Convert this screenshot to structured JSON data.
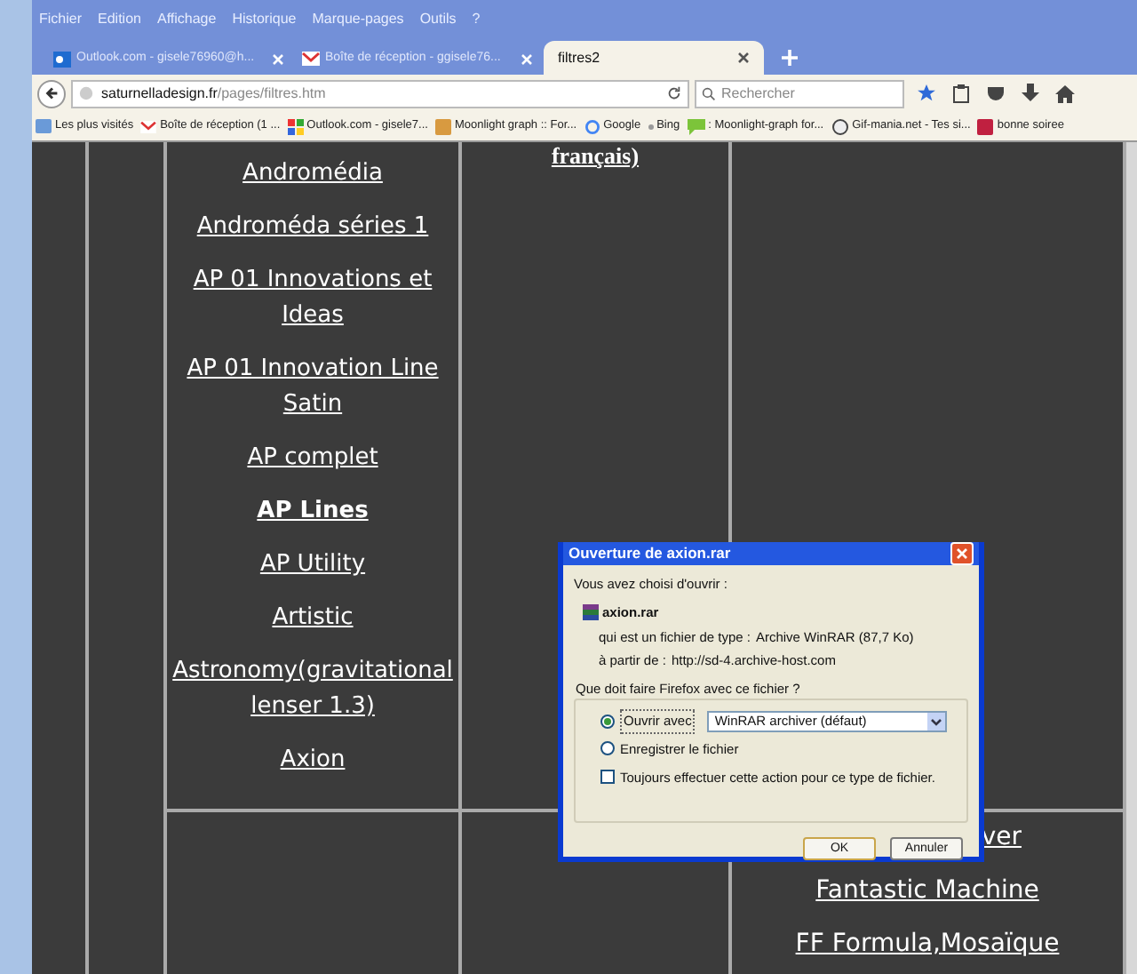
{
  "menu": [
    "Fichier",
    "Edition",
    "Affichage",
    "Historique",
    "Marque-pages",
    "Outils",
    "?"
  ],
  "tabs": [
    {
      "label": "Outlook.com - gisele76960@h...",
      "selected": false,
      "kind": "outlook"
    },
    {
      "label": "Boîte de réception - ggisele76...",
      "selected": false,
      "kind": "gmail"
    },
    {
      "label": "filtres2",
      "selected": true,
      "kind": "plain"
    }
  ],
  "address": {
    "host": "saturnelladesign.fr",
    "path": "/pages/filtres.htm"
  },
  "search": {
    "placeholder": "Rechercher"
  },
  "bookmarks": [
    {
      "label": "Les plus visités",
      "kind": "star"
    },
    {
      "label": "Boîte de réception (1 ...",
      "kind": "gmail"
    },
    {
      "label": "Outlook.com - gisele7...",
      "kind": "windows"
    },
    {
      "label": "Moonlight graph :: For...",
      "kind": "moon"
    },
    {
      "label": "Google",
      "kind": "google"
    },
    {
      "label": "Bing",
      "kind": "dot"
    },
    {
      "label": ": Moonlight-graph for...",
      "kind": "chat"
    },
    {
      "label": "Gif-mania.net - Tes si...",
      "kind": "gif"
    },
    {
      "label": "bonne soiree",
      "kind": "red"
    }
  ],
  "content": {
    "column_3_top": "français)",
    "links": [
      {
        "label": "Andromédia",
        "bold": false
      },
      {
        "label": "Androméda séries 1",
        "bold": false
      },
      {
        "label": "AP 01 Innovations et Ideas",
        "bold": false
      },
      {
        "label": "AP 01 Innovation Line Satin",
        "bold": false
      },
      {
        "label": "AP complet",
        "bold": false
      },
      {
        "label": "AP Lines",
        "bold": true
      },
      {
        "label": "AP Utility",
        "bold": false
      },
      {
        "label": "Artistic",
        "bold": false
      },
      {
        "label": "Astronomy(gravitational lenser 1.3)",
        "bold": false
      },
      {
        "label": "Axion",
        "bold": false
      }
    ],
    "lower_links": [
      "ver",
      "Fantastic Machine",
      "FF Formula,Mosaïque"
    ]
  },
  "dialog": {
    "title": "Ouverture de axion.rar",
    "intro": "Vous avez choisi d'ouvrir :",
    "file": "axion.rar",
    "type_label": "qui est un fichier de type :",
    "type_value": "Archive WinRAR (87,7 Ko)",
    "from_label": "à partir de :",
    "from_value": "http://sd-4.archive-host.com",
    "question": "Que doit faire Firefox avec ce fichier ?",
    "options": [
      {
        "label": "Ouvrir avec",
        "selected": true
      },
      {
        "label": "Enregistrer le fichier",
        "selected": false
      }
    ],
    "app": "WinRAR archiver (défaut)",
    "always": {
      "label": "Toujours effectuer cette action pour ce type de fichier.",
      "checked": false
    },
    "buttons": [
      "OK",
      "Annuler"
    ]
  }
}
